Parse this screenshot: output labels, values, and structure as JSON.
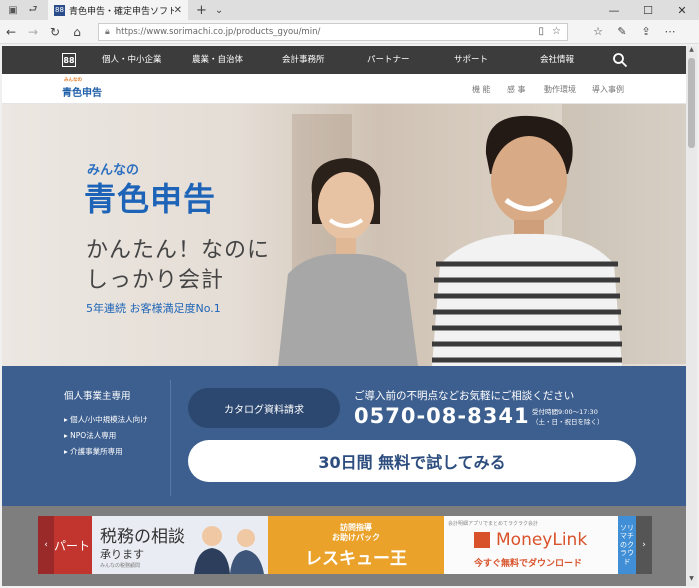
{
  "browser": {
    "tab_title": "青色申告・確定申告ソフト",
    "tab_favicon": "88",
    "url": "https://www.sorimachi.co.jp/products_gyou/min/",
    "icons": [
      "tab-list-icon",
      "back-tabs-icon",
      "close-icon",
      "plus-icon",
      "chevron-down-icon",
      "back-icon",
      "forward-icon",
      "refresh-icon",
      "home-icon",
      "lock-icon",
      "reader-icon",
      "star-icon",
      "favorites-icon",
      "pen-icon",
      "share-icon",
      "more-icon"
    ]
  },
  "site_nav": {
    "logo": "88",
    "items": [
      "個人・中小企業",
      "農業・自治体",
      "会計事務所",
      "パートナー",
      "サポート",
      "会社情報"
    ]
  },
  "sub_nav": {
    "brand_ruby": "みんなの",
    "brand": "青色申告",
    "items": [
      "機 能",
      "感 事",
      "動作環境",
      "導入事例"
    ]
  },
  "hero": {
    "ruby": "みんなの",
    "title": "青色申告",
    "tagline_1": "かんたん！なのに",
    "tagline_2": "しっかり会計",
    "badge": "5年連続 お客様満足度No.1"
  },
  "cta": {
    "side_title": "個人事業主専用",
    "side_links": [
      "個人/小中規模法人向け",
      "NPO法人専用",
      "介護事業所専用"
    ],
    "catalog_button": "カタログ資料請求",
    "lead": "ご導入前の不明点などお気軽にご相談ください",
    "phone": "0570-08-8341",
    "hours_1": "受付時間9:00〜17:30",
    "hours_2": "（土・日・祝日を除く）",
    "trial_button": "30日間 無料で試してみる"
  },
  "carousel": {
    "prev": "‹",
    "next": "›",
    "partial_left": "パート",
    "banner1_title": "税務の相談",
    "banner1_sub": "承ります",
    "banner1_small": "みんなの税務顧問",
    "banner2_top1": "訪問指導",
    "banner2_top2": "お助けパック",
    "banner2_title": "レスキュー王",
    "banner3_top": "会計明細アプリでまとめてラクラク会計",
    "banner3_brand": "MoneyLink",
    "banner3_cta": "今すぐ無料でダウンロード",
    "partial_right": "ソリマチのクラウド"
  },
  "colors": {
    "brand_blue": "#1d64b8",
    "cta_band": "#3d5f8f",
    "nav_dark": "#3c3c3c",
    "banner_orange": "#eaa22b",
    "moneylink_orange": "#d8522a"
  }
}
